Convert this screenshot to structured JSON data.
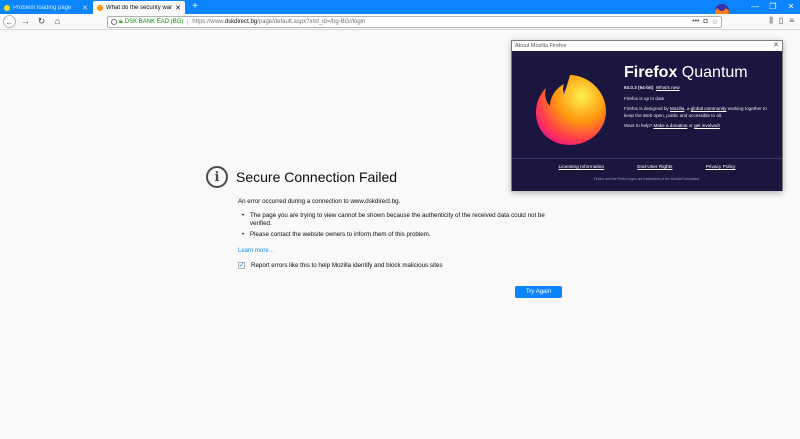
{
  "tabs": [
    {
      "title": "Problem loading page",
      "active": false
    },
    {
      "title": "What do the security warnin",
      "active": true
    }
  ],
  "newtab_label": "+",
  "window_controls": [
    "—",
    "❐",
    "✕"
  ],
  "urlbar": {
    "cert": "DSK BANK EAD (BG)",
    "url_prefix": "https://www.",
    "url_domain": "dskdirect.bg",
    "url_path": "/page/default.aspx?xml_id=/bg-BG//login"
  },
  "error": {
    "title": "Secure Connection Failed",
    "description": "An error occurred during a connection to www.dskdirect.bg.",
    "bullets": [
      "The page you are trying to view cannot be shown because the authenticity of the received data could not be verified.",
      "Please contact the website owners to inform them of this problem."
    ],
    "learn_more": "Learn more…",
    "report_label": "Report errors like this to help Mozilla identify and block malicious sites",
    "report_checked": true,
    "try_again": "Try Again"
  },
  "about": {
    "window_title": "About Mozilla Firefox",
    "brand_first": "Firefox",
    "brand_second": "Quantum",
    "version": "63.0.3 (64-bit)",
    "whats_new": "What's new",
    "status": "Firefox is up to date",
    "designed_prefix": "Firefox is designed by",
    "designed_mozilla": "Mozilla",
    "designed_mid": ", a",
    "designed_community": "global community",
    "designed_suffix": "working together to keep the Web open, public and accessible to all.",
    "help_prefix": "Want to help?",
    "help_donation": "Make a donation",
    "help_or": "or",
    "help_involved": "get involved!",
    "links": [
      "Licensing Information",
      "End-User Rights",
      "Privacy Policy"
    ],
    "trademark": "Firefox and the Firefox logos are trademarks of the Mozilla Foundation."
  },
  "colors": {
    "accent": "#0a84ff",
    "secure_green": "#058b00",
    "about_bg": "#1a1640"
  }
}
